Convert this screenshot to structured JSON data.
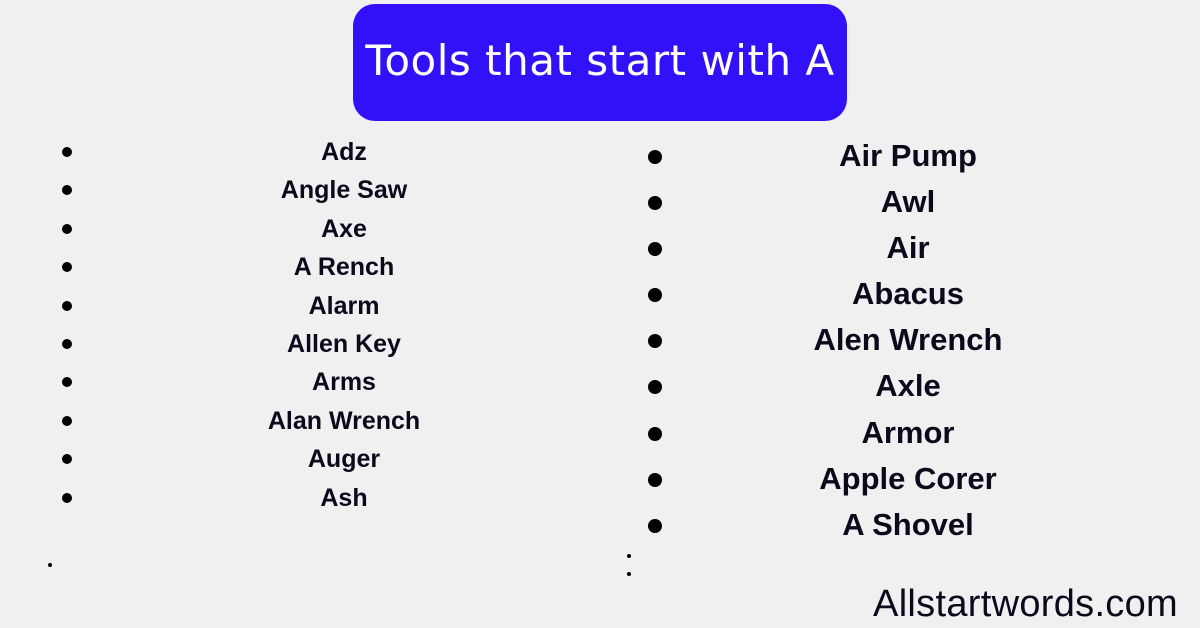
{
  "title": "Tools that start with A",
  "colors": {
    "title_background": "#3311f8",
    "title_text": "#ffffff",
    "page_background": "#f0f0f1",
    "text": "#0a0a1a"
  },
  "left_list": {
    "items": [
      "Adz",
      "Angle Saw",
      "Axe",
      "A Rench",
      "Alarm",
      "Allen Key",
      "Arms",
      "Alan Wrench",
      "Auger",
      "Ash"
    ]
  },
  "right_list": {
    "items": [
      "Air Pump",
      "Awl",
      "Air",
      "Abacus",
      "Alen Wrench",
      "Axle",
      "Armor",
      "Apple Corer",
      "A Shovel"
    ]
  },
  "footer": {
    "site": "Allstartwords.com"
  }
}
